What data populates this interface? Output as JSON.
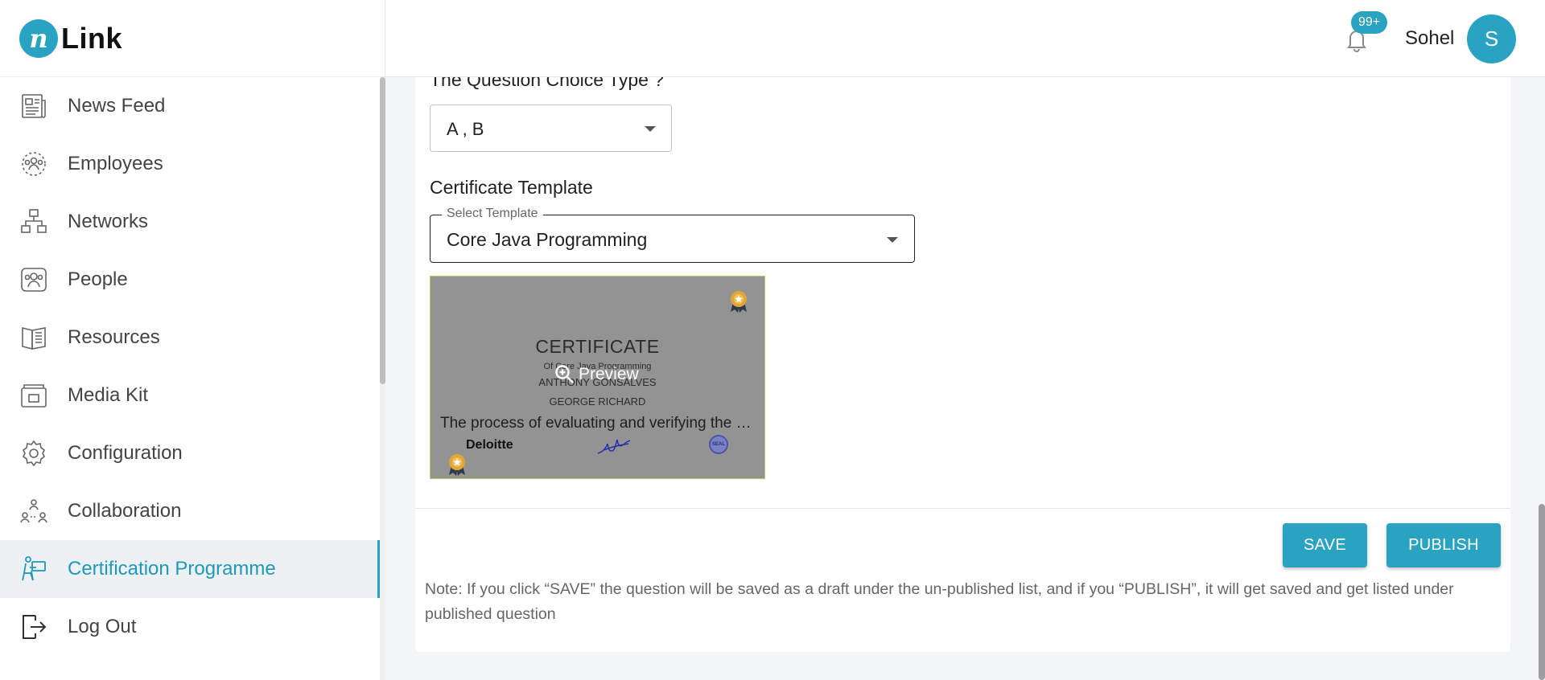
{
  "app": {
    "logo_letter": "n",
    "logo_text": "Link"
  },
  "sidebar": {
    "items": [
      {
        "label": "News Feed",
        "icon": "newspaper-icon"
      },
      {
        "label": "Employees",
        "icon": "employees-icon"
      },
      {
        "label": "Networks",
        "icon": "network-icon"
      },
      {
        "label": "People",
        "icon": "people-icon"
      },
      {
        "label": "Resources",
        "icon": "book-icon"
      },
      {
        "label": "Media Kit",
        "icon": "media-kit-icon"
      },
      {
        "label": "Configuration",
        "icon": "gear-icon"
      },
      {
        "label": "Collaboration",
        "icon": "collaboration-icon"
      },
      {
        "label": "Certification Programme",
        "icon": "certification-icon",
        "active": true
      },
      {
        "label": "Log Out",
        "icon": "logout-icon"
      }
    ]
  },
  "header": {
    "notification_count": "99+",
    "user_name": "Sohel",
    "avatar_initial": "S"
  },
  "form": {
    "question_choice_label": "The Question Choice Type ?",
    "question_choice_value": "A , B",
    "certificate_heading": "Certificate Template",
    "template_select_label": "Select Template",
    "template_select_value": "Core Java Programming"
  },
  "certificate": {
    "title": "CERTIFICATE",
    "of_line": "Of Core Java Programming",
    "name1": "ANTHONY GONSALVES",
    "name2": "GEORGE RICHARD",
    "description": "The process of evaluating and verifying the knowledge and skills",
    "company": "Deloitte",
    "seal_text": "SEAL",
    "preview_label": "Preview"
  },
  "actions": {
    "save_label": "SAVE",
    "publish_label": "PUBLISH"
  },
  "note": "Note: If you click “SAVE” the question will be saved as a draft under the un-published list, and if you “PUBLISH”, it will get saved and get listed under published question",
  "colors": {
    "accent": "#2aa2c2",
    "active_text": "#1f98b9",
    "certificate_bg": "#939393"
  }
}
